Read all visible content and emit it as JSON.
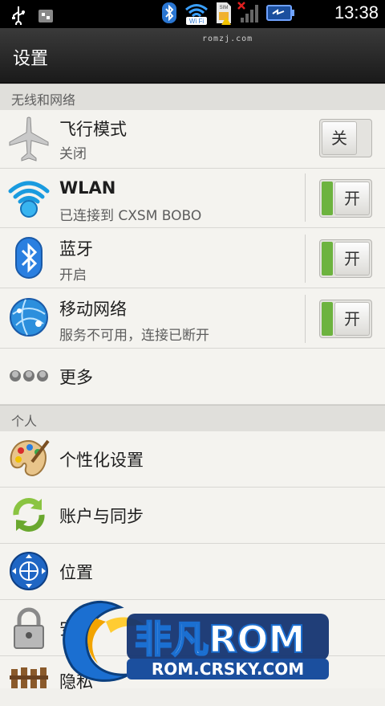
{
  "status_bar": {
    "time": "13:38",
    "icons": [
      "usb-icon",
      "debug-icon",
      "bluetooth-icon",
      "wifi-icon",
      "sim-icon",
      "signal-icon",
      "battery-icon"
    ],
    "wifi_text": "Wi Fi",
    "sim_text": "SIM"
  },
  "header": {
    "title": "设置",
    "watermark": "romzj.com"
  },
  "sections": {
    "wireless": "无线和网络",
    "personal": "个人"
  },
  "items": {
    "airplane": {
      "title": "飞行模式",
      "subtitle": "关闭",
      "toggle": "关",
      "state": "off"
    },
    "wlan": {
      "title": "WLAN",
      "subtitle": "已连接到 CXSM BOBO",
      "toggle": "开",
      "state": "on"
    },
    "bluetooth": {
      "title": "蓝牙",
      "subtitle": "开启",
      "toggle": "开",
      "state": "on"
    },
    "mobile": {
      "title": "移动网络",
      "subtitle": "服务不可用，连接已断开",
      "toggle": "开",
      "state": "on"
    },
    "more": {
      "title": "更多"
    },
    "personalize": {
      "title": "个性化设置"
    },
    "accounts": {
      "title": "账户与同步"
    },
    "location": {
      "title": "位置"
    },
    "security": {
      "title": "安全"
    },
    "privacy": {
      "title": "隐私"
    }
  },
  "watermark_logo": {
    "brand": "非凡ROM",
    "url": "ROM.CRSKY.COM"
  },
  "colors": {
    "toggle_on": "#6db33f",
    "header": "#2a2a2a",
    "background": "#f1f0ec"
  }
}
